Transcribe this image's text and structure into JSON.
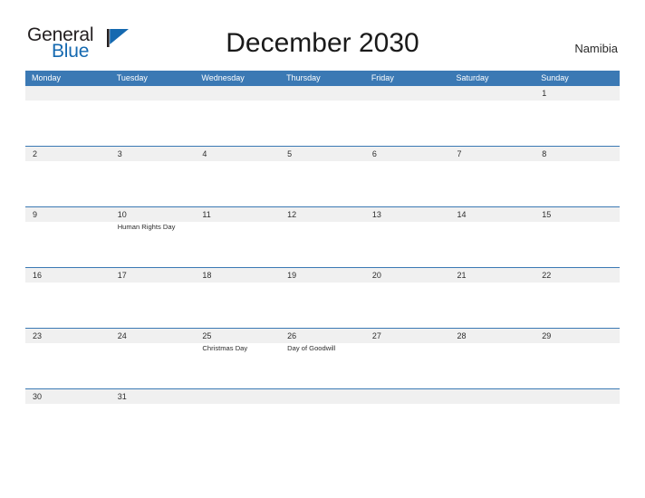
{
  "brand": {
    "name_primary": "General",
    "name_secondary": "Blue",
    "mark_icon": "triangle-flag-icon",
    "color_primary": "#231f20",
    "color_secondary": "#1569b0"
  },
  "header": {
    "title": "December 2030",
    "country": "Namibia",
    "accent_color": "#3b79b4"
  },
  "calendar": {
    "weekdays": [
      "Monday",
      "Tuesday",
      "Wednesday",
      "Thursday",
      "Friday",
      "Saturday",
      "Sunday"
    ],
    "band_color": "#f0f0f0",
    "weeks": [
      {
        "days": [
          {
            "number": "",
            "event": ""
          },
          {
            "number": "",
            "event": ""
          },
          {
            "number": "",
            "event": ""
          },
          {
            "number": "",
            "event": ""
          },
          {
            "number": "",
            "event": ""
          },
          {
            "number": "",
            "event": ""
          },
          {
            "number": "1",
            "event": ""
          }
        ]
      },
      {
        "days": [
          {
            "number": "2",
            "event": ""
          },
          {
            "number": "3",
            "event": ""
          },
          {
            "number": "4",
            "event": ""
          },
          {
            "number": "5",
            "event": ""
          },
          {
            "number": "6",
            "event": ""
          },
          {
            "number": "7",
            "event": ""
          },
          {
            "number": "8",
            "event": ""
          }
        ]
      },
      {
        "days": [
          {
            "number": "9",
            "event": ""
          },
          {
            "number": "10",
            "event": "Human Rights Day"
          },
          {
            "number": "11",
            "event": ""
          },
          {
            "number": "12",
            "event": ""
          },
          {
            "number": "13",
            "event": ""
          },
          {
            "number": "14",
            "event": ""
          },
          {
            "number": "15",
            "event": ""
          }
        ]
      },
      {
        "days": [
          {
            "number": "16",
            "event": ""
          },
          {
            "number": "17",
            "event": ""
          },
          {
            "number": "18",
            "event": ""
          },
          {
            "number": "19",
            "event": ""
          },
          {
            "number": "20",
            "event": ""
          },
          {
            "number": "21",
            "event": ""
          },
          {
            "number": "22",
            "event": ""
          }
        ]
      },
      {
        "days": [
          {
            "number": "23",
            "event": ""
          },
          {
            "number": "24",
            "event": ""
          },
          {
            "number": "25",
            "event": "Christmas Day"
          },
          {
            "number": "26",
            "event": "Day of Goodwill"
          },
          {
            "number": "27",
            "event": ""
          },
          {
            "number": "28",
            "event": ""
          },
          {
            "number": "29",
            "event": ""
          }
        ]
      },
      {
        "days": [
          {
            "number": "30",
            "event": ""
          },
          {
            "number": "31",
            "event": ""
          },
          {
            "number": "",
            "event": ""
          },
          {
            "number": "",
            "event": ""
          },
          {
            "number": "",
            "event": ""
          },
          {
            "number": "",
            "event": ""
          },
          {
            "number": "",
            "event": ""
          }
        ]
      }
    ]
  }
}
